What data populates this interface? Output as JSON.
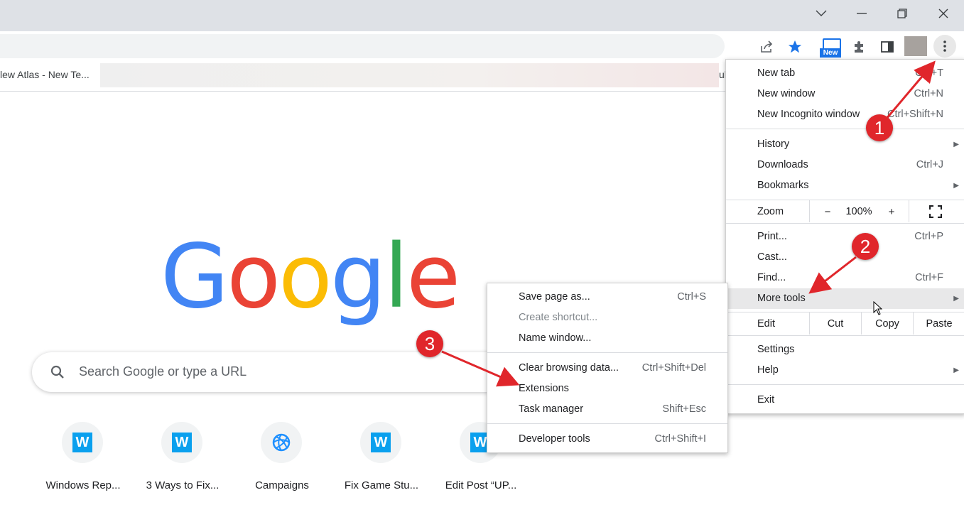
{
  "titlebar": {
    "icons": [
      "chevron-down-icon",
      "minimize-icon",
      "restore-icon",
      "close-icon"
    ]
  },
  "toolbar": {
    "new_badge": "New",
    "icons": [
      "share-icon",
      "star-icon",
      "extension-new-icon",
      "puzzle-icon",
      "side-panel-icon",
      "profile-avatar",
      "more-vert-icon"
    ]
  },
  "bookmarks": {
    "item1": "lew Atlas - New Te...",
    "clipped": "ul"
  },
  "logo": {
    "letters": [
      "G",
      "o",
      "o",
      "g",
      "l",
      "e"
    ],
    "colors": [
      "#4285f4",
      "#ea4335",
      "#fbbc05",
      "#4285f4",
      "#34a853",
      "#ea4335"
    ]
  },
  "search": {
    "placeholder": "Search Google or type a URL"
  },
  "shortcuts": [
    {
      "label": "Windows Rep...",
      "icon": "W"
    },
    {
      "label": "3 Ways to Fix...",
      "icon": "W"
    },
    {
      "label": "Campaigns",
      "icon": ""
    },
    {
      "label": "Fix Game Stu...",
      "icon": "W"
    },
    {
      "label": "Edit Post “UP...",
      "icon": "W"
    }
  ],
  "main_menu": {
    "new_tab": "New tab",
    "new_tab_key": "Ctrl+T",
    "new_window": "New window",
    "new_window_key": "Ctrl+N",
    "incognito": "New Incognito window",
    "incognito_key": "Ctrl+Shift+N",
    "history": "History",
    "downloads": "Downloads",
    "downloads_key": "Ctrl+J",
    "bookmarks": "Bookmarks",
    "zoom": "Zoom",
    "zoom_minus": "−",
    "zoom_level": "100%",
    "zoom_plus": "+",
    "print": "Print...",
    "print_key": "Ctrl+P",
    "cast": "Cast...",
    "find": "Find...",
    "find_key": "Ctrl+F",
    "more_tools": "More tools",
    "edit": "Edit",
    "cut": "Cut",
    "copy": "Copy",
    "paste": "Paste",
    "settings": "Settings",
    "help": "Help",
    "exit": "Exit"
  },
  "submenu": {
    "save_page": "Save page as...",
    "save_page_key": "Ctrl+S",
    "create_shortcut": "Create shortcut...",
    "name_window": "Name window...",
    "clear_data": "Clear browsing data...",
    "clear_data_key": "Ctrl+Shift+Del",
    "extensions": "Extensions",
    "task_manager": "Task manager",
    "task_manager_key": "Shift+Esc",
    "dev_tools": "Developer tools",
    "dev_tools_key": "Ctrl+Shift+I"
  },
  "annotations": {
    "step1": "1",
    "step2": "2",
    "step3": "3",
    "color": "#e0262b"
  }
}
